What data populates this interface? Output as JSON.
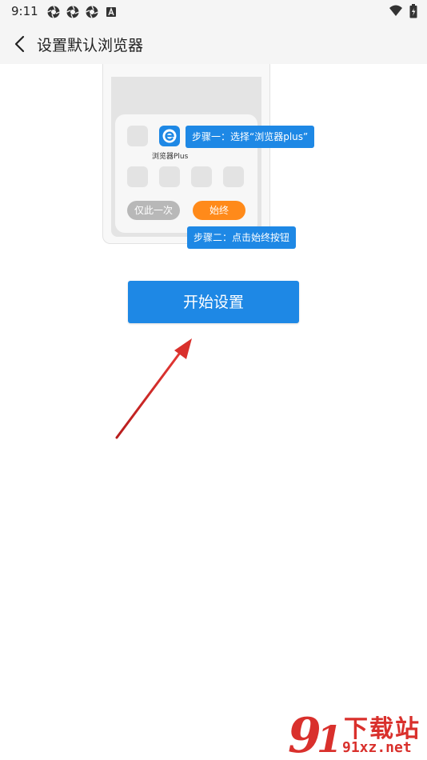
{
  "status_bar": {
    "time": "9:11"
  },
  "app_bar": {
    "title": "设置默认浏览器"
  },
  "illustration": {
    "app_label": "浏览器Plus",
    "once_label": "仅此一次",
    "always_label": "始终",
    "step1": "步骤一：选择“浏览器plus”",
    "step2": "步骤二：点击始终按钮"
  },
  "start_button": {
    "label": "开始设置"
  },
  "watermark": {
    "line1": "下载站",
    "line2": "91xz.net"
  },
  "colors": {
    "accent": "#1e88e5",
    "orange": "#ff8a1a",
    "arrow": "#d9302c"
  }
}
